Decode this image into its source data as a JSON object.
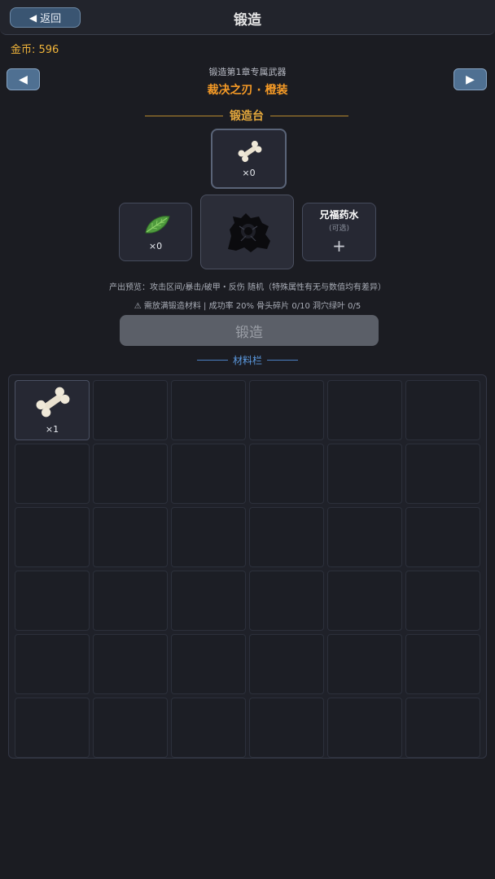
{
  "header": {
    "back_label": "返回",
    "title": "锻造"
  },
  "currency": {
    "gold_text": "金币: 596"
  },
  "weapon": {
    "subtitle": "锻造第1章专属武器",
    "name": "裁决之刃 · 橙装"
  },
  "forge_table": {
    "title": "锻造台",
    "top_slot": {
      "icon": "bone-icon",
      "count": "×0"
    },
    "left_slot": {
      "icon": "leaf-icon",
      "count": "×0"
    },
    "center_slot": {
      "icon": "weapon-silhouette-icon"
    },
    "right_slot": {
      "title": "兄福药水",
      "optional": "(可选)",
      "plus": "+"
    }
  },
  "info": {
    "output_preview": "产出预览：攻击区间/暴击/破甲・反伤 随机（特殊属性有无与数值均有差异）",
    "requirement": "⚠ 需放满锻造材料 | 成功率 20%   骨头碎片 0/10   洞穴绿叶 0/5"
  },
  "forge_button_label": "锻造",
  "materials": {
    "title": "材料栏",
    "items": [
      {
        "icon": "bone-icon",
        "count": "×1"
      }
    ]
  },
  "colors": {
    "background": "#1b1c22",
    "gold_text": "#f0b43a",
    "weapon_name": "#f59a26",
    "section_title": "#e6a93c",
    "materials_title": "#5c9be2",
    "button_disabled": "#5b5f68"
  }
}
